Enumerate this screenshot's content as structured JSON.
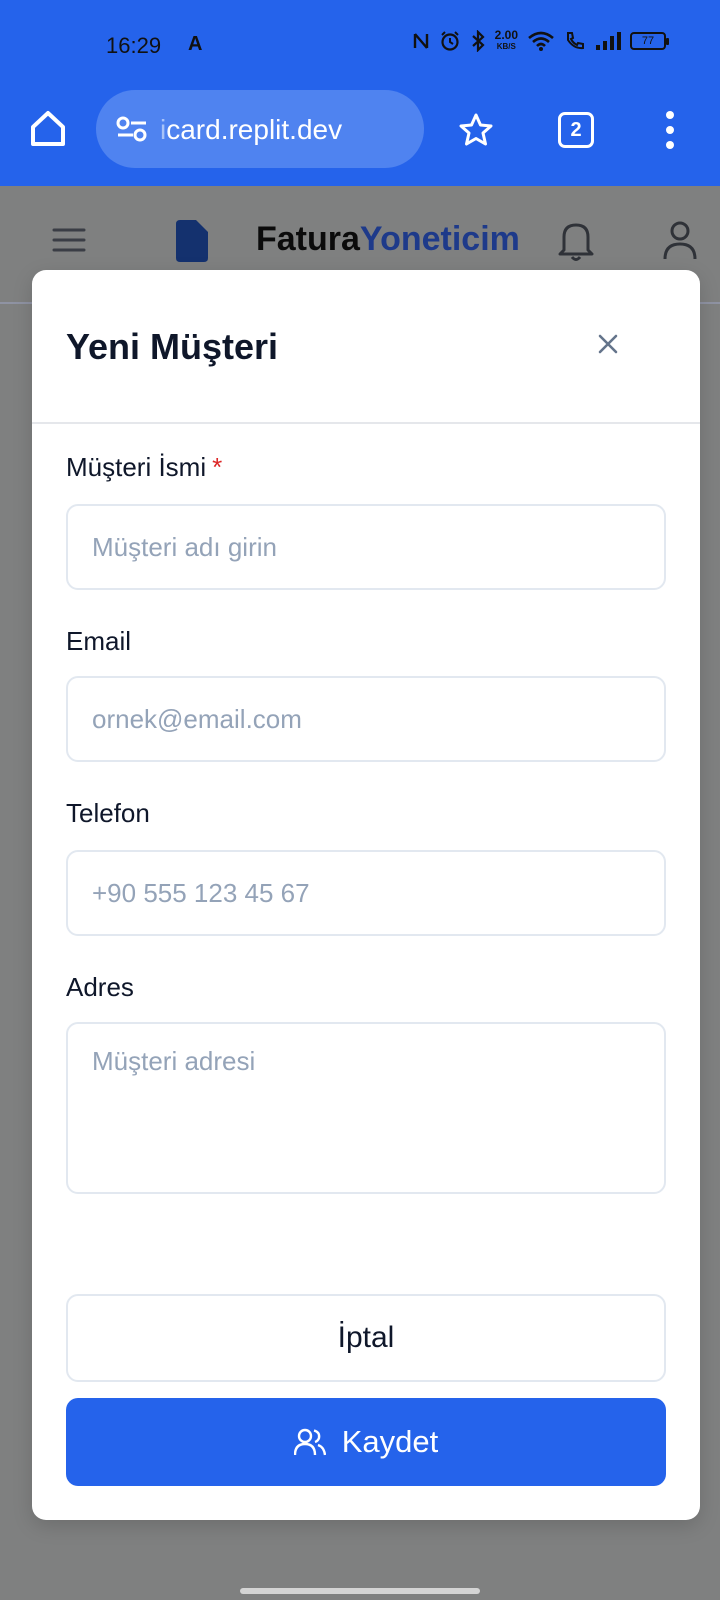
{
  "status_bar": {
    "time": "16:29",
    "network_speed_value": "2.00",
    "network_speed_unit": "KB/S",
    "battery": "77",
    "icons": [
      "a-notification-icon",
      "nfc-icon",
      "alarm-icon",
      "bluetooth-icon",
      "wifi-icon",
      "wifi-call-icon",
      "signal-icon",
      "battery-icon"
    ]
  },
  "browser": {
    "url_hidden_prefix": "i",
    "url": "card.replit.dev",
    "tab_count": "2",
    "icons": [
      "home-icon",
      "site-settings-icon",
      "bookmark-star-icon",
      "tabs-icon",
      "more-vert-icon"
    ]
  },
  "app_header": {
    "brand_part1": "Fatura",
    "brand_part2": "Yoneticim",
    "brand_color_dark": "#0b0b0b",
    "brand_color_accent": "#1e3a8a",
    "icons": [
      "menu-icon",
      "document-icon",
      "bell-icon",
      "user-icon"
    ]
  },
  "modal": {
    "title": "Yeni Müşteri",
    "fields": {
      "name_label": "Müşteri İsmi",
      "name_required": "*",
      "name_placeholder": "Müşteri adı girin",
      "email_label": "Email",
      "email_placeholder": "ornek@email.com",
      "phone_label": "Telefon",
      "phone_placeholder": "+90 555 123 45 67",
      "address_label": "Adres",
      "address_placeholder": "Müşteri adresi"
    },
    "cancel_label": "İptal",
    "save_label": "Kaydet",
    "accent_color": "#2563eb"
  }
}
